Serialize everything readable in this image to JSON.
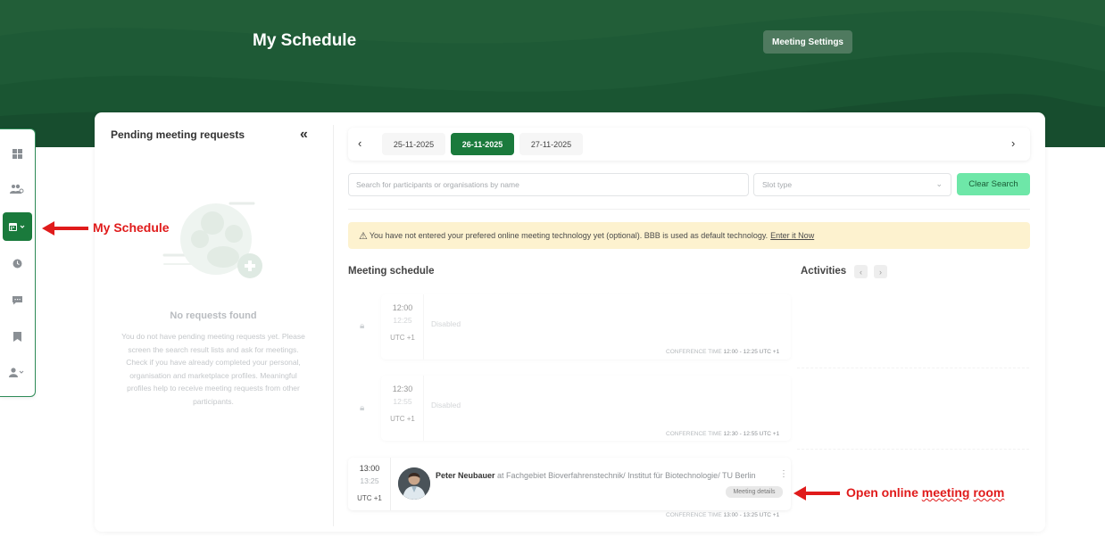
{
  "header": {
    "title": "My Schedule",
    "settings_label": "Meeting Settings"
  },
  "sidenav": {
    "items": [
      {
        "name": "dashboard-icon"
      },
      {
        "name": "people-icon"
      },
      {
        "name": "calendar-icon",
        "active": true
      },
      {
        "name": "clock-icon"
      },
      {
        "name": "chat-icon"
      },
      {
        "name": "bookmark-icon"
      },
      {
        "name": "user-icon"
      }
    ]
  },
  "pending": {
    "title": "Pending meeting requests",
    "collapse": "«",
    "empty_title": "No requests found",
    "empty_desc": "You do not have pending meeting requests yet. Please screen the search result lists and ask for meetings. Check if you have already completed your personal, organisation and marketplace profiles. Meaningful profiles help to receive meeting requests from other participants."
  },
  "dates": {
    "prev": "‹",
    "next": "›",
    "items": [
      "25-11-2025",
      "26-11-2025",
      "27-11-2025"
    ],
    "active_index": 1
  },
  "search": {
    "placeholder": "Search for participants or organisations by name",
    "slot_type_placeholder": "Slot type",
    "clear_label": "Clear Search"
  },
  "warning": {
    "icon": "⚠",
    "text": "You have not entered your prefered online meeting technology yet (optional). BBB is used as default technology.",
    "link": "Enter it Now"
  },
  "schedule": {
    "title": "Meeting schedule",
    "slots": [
      {
        "start": "12:00",
        "end": "12:25",
        "tz": "UTC +1",
        "status": "Disabled",
        "conf_label": "CONFERENCE TIME",
        "conf_time": "12:00 - 12:25 UTC +1"
      },
      {
        "start": "12:30",
        "end": "12:55",
        "tz": "UTC +1",
        "status": "Disabled",
        "conf_label": "CONFERENCE TIME",
        "conf_time": "12:30 - 12:55 UTC +1"
      },
      {
        "start": "13:00",
        "end": "13:25",
        "tz": "UTC +1",
        "person": "Peter Neubauer",
        "org": "at Fachgebiet Bioverfahrenstechnik/ Institut für Biotechnologie/ TU Berlin",
        "details_label": "Meeting details",
        "conf_label": "CONFERENCE TIME",
        "conf_time": "13:00 - 13:25 UTC +1"
      }
    ]
  },
  "activities": {
    "title": "Activities",
    "prev": "‹",
    "next": "›"
  },
  "annotations": {
    "my_schedule": "My Schedule",
    "open_room_prefix": "Open online",
    "open_room_meeting": "meeting",
    "open_room_room": "room",
    "color": "#e01b1b"
  },
  "colors": {
    "brand_green": "#1a7a3c",
    "banner_green": "#1e5a36",
    "clear_button": "#6ee7a8",
    "warning_bg": "#fdf2cf"
  }
}
